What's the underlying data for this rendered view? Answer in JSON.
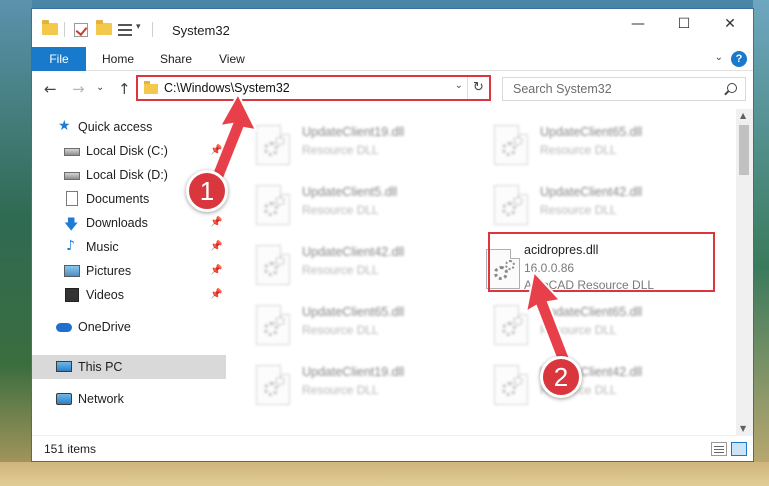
{
  "window": {
    "title": "System32",
    "controls": {
      "minimize": "—",
      "maximize": "☐",
      "close": "✕"
    }
  },
  "ribbon": {
    "file": "File",
    "tabs": [
      "Home",
      "Share",
      "View"
    ],
    "expand": "⌄",
    "help": "?"
  },
  "nav": {
    "back": "←",
    "forward": "→",
    "recent": "⌄",
    "up": "↑"
  },
  "address": {
    "path": "C:\\Windows\\System32",
    "dropdown": "⌄",
    "refresh": "↻"
  },
  "search": {
    "placeholder": "Search System32"
  },
  "sidebar": {
    "items": [
      {
        "label": "Quick access",
        "icon": "star-icon",
        "pinned": false
      },
      {
        "label": "Local Disk (C:)",
        "icon": "disk-icon",
        "pinned": true
      },
      {
        "label": "Local Disk (D:)",
        "icon": "disk-icon",
        "pinned": true
      },
      {
        "label": "Documents",
        "icon": "documents-icon",
        "pinned": true
      },
      {
        "label": "Downloads",
        "icon": "download-icon",
        "pinned": true
      },
      {
        "label": "Music",
        "icon": "music-icon",
        "pinned": true
      },
      {
        "label": "Pictures",
        "icon": "pictures-icon",
        "pinned": true
      },
      {
        "label": "Videos",
        "icon": "videos-icon",
        "pinned": true
      },
      {
        "label": "OneDrive",
        "icon": "onedrive-icon",
        "pinned": false
      },
      {
        "label": "This PC",
        "icon": "this-pc-icon",
        "pinned": false
      },
      {
        "label": "Network",
        "icon": "network-icon",
        "pinned": false
      }
    ],
    "pin_glyph": "📌"
  },
  "files": {
    "left": [
      {
        "name": "UpdateClient19.dll",
        "type": "Resource DLL"
      },
      {
        "name": "UpdateClient5.dll",
        "type": "Resource DLL"
      },
      {
        "name": "UpdateClient42.dll",
        "type": "Resource DLL"
      },
      {
        "name": "UpdateClient65.dll",
        "type": "Resource DLL"
      },
      {
        "name": "UpdateClient19.dll",
        "type": "Resource DLL"
      }
    ],
    "right": [
      {
        "name": "UpdateClient65.dll",
        "type": "Resource DLL"
      },
      {
        "name": "UpdateClient42.dll",
        "type": "Resource DLL"
      },
      {
        "name": "UpdateClient65.dll",
        "type": "Resource DLL"
      },
      {
        "name": "UpdateClient42.dll",
        "type": "Resource DLL"
      }
    ],
    "highlighted": {
      "name": "acidropres.dll",
      "version": "16.0.0.86",
      "description": "AutoCAD  Resource DLL"
    }
  },
  "status": {
    "item_count": "151 items"
  },
  "annotations": {
    "step1": "1",
    "step2": "2"
  },
  "colors": {
    "accent": "#1979ca",
    "highlight": "#d9363e"
  }
}
